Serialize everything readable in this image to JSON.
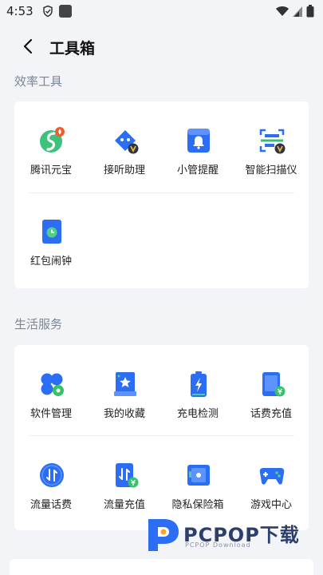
{
  "status_bar": {
    "time": "4:53"
  },
  "header": {
    "title": "工具箱"
  },
  "sections": [
    {
      "title": "效率工具",
      "items": [
        {
          "label": "腾讯元宝",
          "icon": "yuanbao-icon"
        },
        {
          "label": "接听助理",
          "icon": "answer-assistant-icon"
        },
        {
          "label": "小管提醒",
          "icon": "bell-icon"
        },
        {
          "label": "智能扫描仪",
          "icon": "scanner-icon"
        },
        {
          "label": "红包闹钟",
          "icon": "clock-icon"
        }
      ]
    },
    {
      "title": "生活服务",
      "items": [
        {
          "label": "软件管理",
          "icon": "app-manage-icon"
        },
        {
          "label": "我的收藏",
          "icon": "favorites-icon"
        },
        {
          "label": "充电检测",
          "icon": "battery-icon"
        },
        {
          "label": "话费充值",
          "icon": "phone-recharge-icon"
        },
        {
          "label": "流量话费",
          "icon": "data-fee-icon"
        },
        {
          "label": "流量充值",
          "icon": "data-recharge-icon"
        },
        {
          "label": "隐私保险箱",
          "icon": "safe-box-icon"
        },
        {
          "label": "游戏中心",
          "icon": "gamepad-icon"
        }
      ]
    }
  ],
  "watermark": {
    "brand": "PCPOP下载",
    "sub": "PCPOP Download"
  },
  "colors": {
    "accent": "#2b6ef3",
    "green": "#35c26b",
    "badge_red": "#f15a2a",
    "vip_gold": "#e8b64a"
  }
}
